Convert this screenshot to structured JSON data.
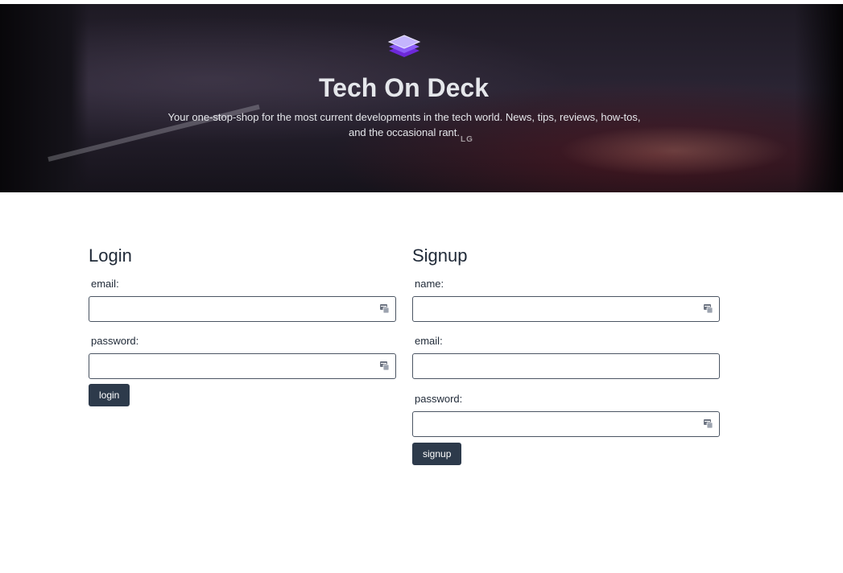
{
  "hero": {
    "title": "Tech On Deck",
    "tagline": "Your one-stop-shop for the most current developments in the tech world. News, tips, reviews, how-tos, and the occasional rant.",
    "monitor_brand": "LG",
    "logo_icon": "stack-layers-icon",
    "logo_colors": [
      "#7c3aed",
      "#a78bfa",
      "#e9d5ff"
    ]
  },
  "login": {
    "heading": "Login",
    "email_label": "email:",
    "email_value": "",
    "password_label": "password:",
    "password_value": "",
    "button_label": "login"
  },
  "signup": {
    "heading": "Signup",
    "name_label": "name:",
    "name_value": "",
    "email_label": "email:",
    "email_value": "",
    "password_label": "password:",
    "password_value": "",
    "button_label": "signup"
  },
  "field_icon": "autofill-card-icon",
  "colors": {
    "button_bg": "#2d3a4b",
    "input_border": "#4b5563",
    "hero_text": "#e5e7eb"
  }
}
